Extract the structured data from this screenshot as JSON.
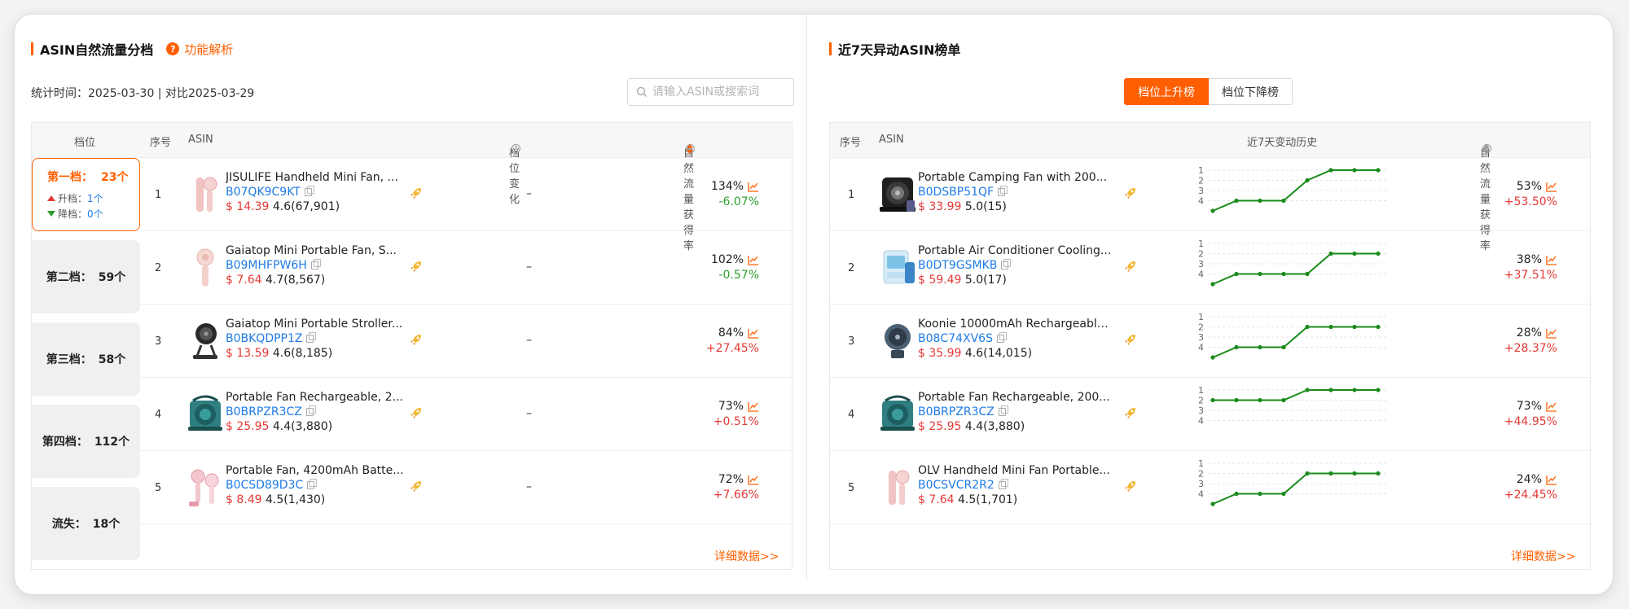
{
  "left": {
    "title": "ASIN自然流量分档",
    "help_label": "功能解析",
    "stat_line": "统计时间：2025-03-30 | 对比2025-03-29",
    "search_placeholder": "请输入ASIN或搜索词",
    "headers": {
      "tier": "档位",
      "idx": "序号",
      "asin": "ASIN",
      "change": "档位变化",
      "rate": "自然流量获得率"
    },
    "tiers": [
      {
        "label": "第一档：",
        "count": "23个",
        "up_label": "升档：",
        "up_value": "1个",
        "down_label": "降档：",
        "down_value": "0个"
      },
      {
        "label": "第二档：",
        "count": "59个"
      },
      {
        "label": "第三档：",
        "count": "58个"
      },
      {
        "label": "第四档：",
        "count": "112个"
      },
      {
        "label": "流失：",
        "count": "18个"
      }
    ],
    "rows": [
      {
        "idx": "1",
        "title": "JISULIFE Handheld Mini Fan, ...",
        "asin": "B07QK9C9KT",
        "price": "$ 14.39",
        "rating": "4.6(67,901)",
        "change": "–",
        "rate": "134%",
        "delta": "-6.07%",
        "dir": "neg",
        "img": "pink-stick"
      },
      {
        "idx": "2",
        "title": "Gaiatop Mini Portable Fan, S...",
        "asin": "B09MHFPW6H",
        "price": "$ 7.64",
        "rating": "4.7(8,567)",
        "change": "–",
        "rate": "102%",
        "delta": "-0.57%",
        "dir": "neg",
        "img": "pink-round"
      },
      {
        "idx": "3",
        "title": "Gaiatop Mini Portable Stroller...",
        "asin": "B0BKQDPP1Z",
        "price": "$ 13.59",
        "rating": "4.6(8,185)",
        "change": "–",
        "rate": "84%",
        "delta": "+27.45%",
        "dir": "pos",
        "img": "black-clip"
      },
      {
        "idx": "4",
        "title": "Portable Fan Rechargeable, 2...",
        "asin": "B0BRPZR3CZ",
        "price": "$ 25.95",
        "rating": "4.4(3,880)",
        "change": "–",
        "rate": "73%",
        "delta": "+0.51%",
        "dir": "pos",
        "img": "teal-camp"
      },
      {
        "idx": "5",
        "title": "Portable Fan, 4200mAh Batte...",
        "asin": "B0CSD89D3C",
        "price": "$ 8.49",
        "rating": "4.5(1,430)",
        "change": "–",
        "rate": "72%",
        "delta": "+7.66%",
        "dir": "pos",
        "img": "pink-pair"
      }
    ],
    "more": "详细数据>>"
  },
  "right": {
    "title": "近7天异动ASIN榜单",
    "tabs": [
      "档位上升榜",
      "档位下降榜"
    ],
    "headers": {
      "idx": "序号",
      "asin": "ASIN",
      "history": "近7天变动历史",
      "rate": "自然流量获得率"
    },
    "axis_labels": [
      "1",
      "2",
      "3",
      "4"
    ],
    "rows": [
      {
        "idx": "1",
        "title": "Portable Camping Fan with 200...",
        "asin": "B0DSBP51QF",
        "price": "$ 33.99",
        "rating": "5.0(15)",
        "rate": "53%",
        "delta": "+53.50%",
        "img": "black-camp",
        "history": [
          5,
          4,
          4,
          4,
          2,
          1,
          1,
          1
        ]
      },
      {
        "idx": "2",
        "title": "Portable Air Conditioner Cooling...",
        "asin": "B0DT9GSMKB",
        "price": "$ 59.49",
        "rating": "5.0(17)",
        "rate": "38%",
        "delta": "+37.51%",
        "img": "blue-cooler",
        "history": [
          5,
          4,
          4,
          4,
          4,
          2,
          2,
          2
        ]
      },
      {
        "idx": "3",
        "title": "Koonie 10000mAh Rechargeable...",
        "asin": "B08C74XV6S",
        "price": "$ 35.99",
        "rating": "4.6(14,015)",
        "rate": "28%",
        "delta": "+28.37%",
        "img": "grey-desk",
        "history": [
          5,
          4,
          4,
          4,
          2,
          2,
          2,
          2
        ]
      },
      {
        "idx": "4",
        "title": "Portable Fan Rechargeable, 200...",
        "asin": "B0BRPZR3CZ",
        "price": "$ 25.95",
        "rating": "4.4(3,880)",
        "rate": "73%",
        "delta": "+44.95%",
        "img": "teal-camp",
        "history": [
          2,
          2,
          2,
          2,
          1,
          1,
          1,
          1
        ]
      },
      {
        "idx": "5",
        "title": "OLV Handheld Mini Fan Portable...",
        "asin": "B0CSVCR2R2",
        "price": "$ 7.64",
        "rating": "4.5(1,701)",
        "rate": "24%",
        "delta": "+24.45%",
        "img": "pink-stick",
        "history": [
          5,
          4,
          4,
          4,
          2,
          2,
          2,
          2
        ]
      }
    ],
    "more": "详细数据>>"
  },
  "colors": {
    "accent": "#ff5f00",
    "link": "#1e7be6",
    "up": "#e53935",
    "down": "#2e9e2e",
    "line": "#1a8a1a"
  }
}
